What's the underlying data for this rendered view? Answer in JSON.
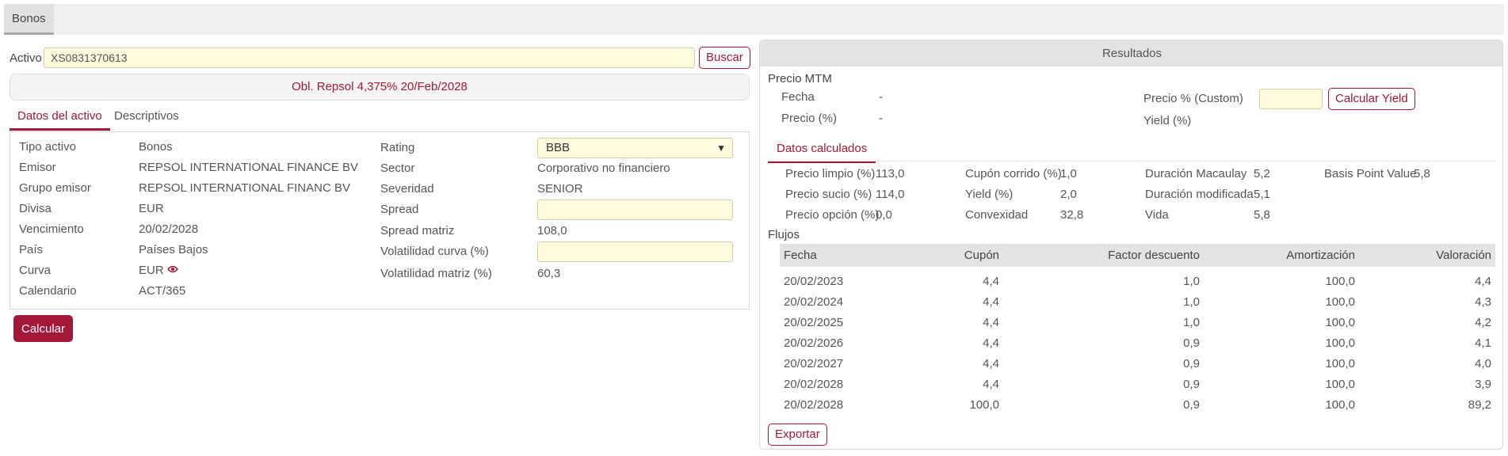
{
  "topbar": {
    "tab_label": "Bonos"
  },
  "asset": {
    "label": "Activo",
    "value": "XS0831370613",
    "search_label": "Buscar",
    "name": "Obl. Repsol 4,375% 20/Feb/2028"
  },
  "subtabs": [
    {
      "label": "Datos del activo"
    },
    {
      "label": "Descriptivos"
    }
  ],
  "details_left": [
    {
      "label": "Tipo activo",
      "value": "Bonos"
    },
    {
      "label": "Emisor",
      "value": "REPSOL INTERNATIONAL FINANCE BV"
    },
    {
      "label": "Grupo emisor",
      "value": "REPSOL INTERNATIONAL FINANC BV"
    },
    {
      "label": "Divisa",
      "value": "EUR"
    },
    {
      "label": "Vencimiento",
      "value": "20/02/2028"
    },
    {
      "label": "País",
      "value": "Países Bajos"
    },
    {
      "label": "Curva",
      "value": "EUR"
    },
    {
      "label": "Calendario",
      "value": "ACT/365"
    }
  ],
  "details_right": {
    "rating": {
      "label": "Rating",
      "selected": "BBB"
    },
    "sector": {
      "label": "Sector",
      "value": "Corporativo no financiero"
    },
    "severidad": {
      "label": "Severidad",
      "value": "SENIOR"
    },
    "spread": {
      "label": "Spread",
      "value": ""
    },
    "spread_matriz": {
      "label": "Spread matriz",
      "value": "108,0"
    },
    "vol_curva": {
      "label": "Volatilidad curva (%)",
      "value": ""
    },
    "vol_matriz": {
      "label": "Volatilidad matriz (%)",
      "value": "60,3"
    }
  },
  "calculate_label": "Calcular",
  "results": {
    "header": "Resultados",
    "mtm": {
      "title": "Precio MTM",
      "fecha_label": "Fecha",
      "fecha_value": "-",
      "precio_label": "Precio (%)",
      "precio_value": "-",
      "custom_label": "Precio % (Custom)",
      "custom_value": "",
      "calc_yield_label": "Calcular Yield",
      "yield_label": "Yield (%)"
    },
    "calc_tab": "Datos calculados",
    "calculated": [
      {
        "label": "Precio limpio (%)",
        "value": "113,0"
      },
      {
        "label": "Cupón corrido (%)",
        "value": "1,0"
      },
      {
        "label": "Duración Macaulay",
        "value": "5,2"
      },
      {
        "label": "Basis Point Value",
        "value": "5,8"
      },
      {
        "label": "Precio sucio (%)",
        "value": "114,0"
      },
      {
        "label": "Yield (%)",
        "value": "2,0"
      },
      {
        "label": "Duración modificada",
        "value": "5,1"
      },
      {
        "label": "Precio opción (%)",
        "value": "0,0"
      },
      {
        "label": "Convexidad",
        "value": "32,8"
      },
      {
        "label": "Vida",
        "value": "5,8"
      }
    ],
    "flows_title": "Flujos",
    "flows_columns": [
      "Fecha",
      "Cupón",
      "Factor descuento",
      "Amortización",
      "Valoración"
    ],
    "flows_rows": [
      [
        "20/02/2023",
        "4,4",
        "1,0",
        "100,0",
        "4,4"
      ],
      [
        "20/02/2024",
        "4,4",
        "1,0",
        "100,0",
        "4,3"
      ],
      [
        "20/02/2025",
        "4,4",
        "1,0",
        "100,0",
        "4,2"
      ],
      [
        "20/02/2026",
        "4,4",
        "0,9",
        "100,0",
        "4,1"
      ],
      [
        "20/02/2027",
        "4,4",
        "0,9",
        "100,0",
        "4,0"
      ],
      [
        "20/02/2028",
        "4,4",
        "0,9",
        "100,0",
        "3,9"
      ],
      [
        "20/02/2028",
        "100,0",
        "0,9",
        "100,0",
        "89,2"
      ]
    ],
    "export_label": "Exportar"
  },
  "colors": {
    "accent": "#a31838",
    "input_bg": "#fdfbdc",
    "header_bg": "#e3e3e3"
  }
}
